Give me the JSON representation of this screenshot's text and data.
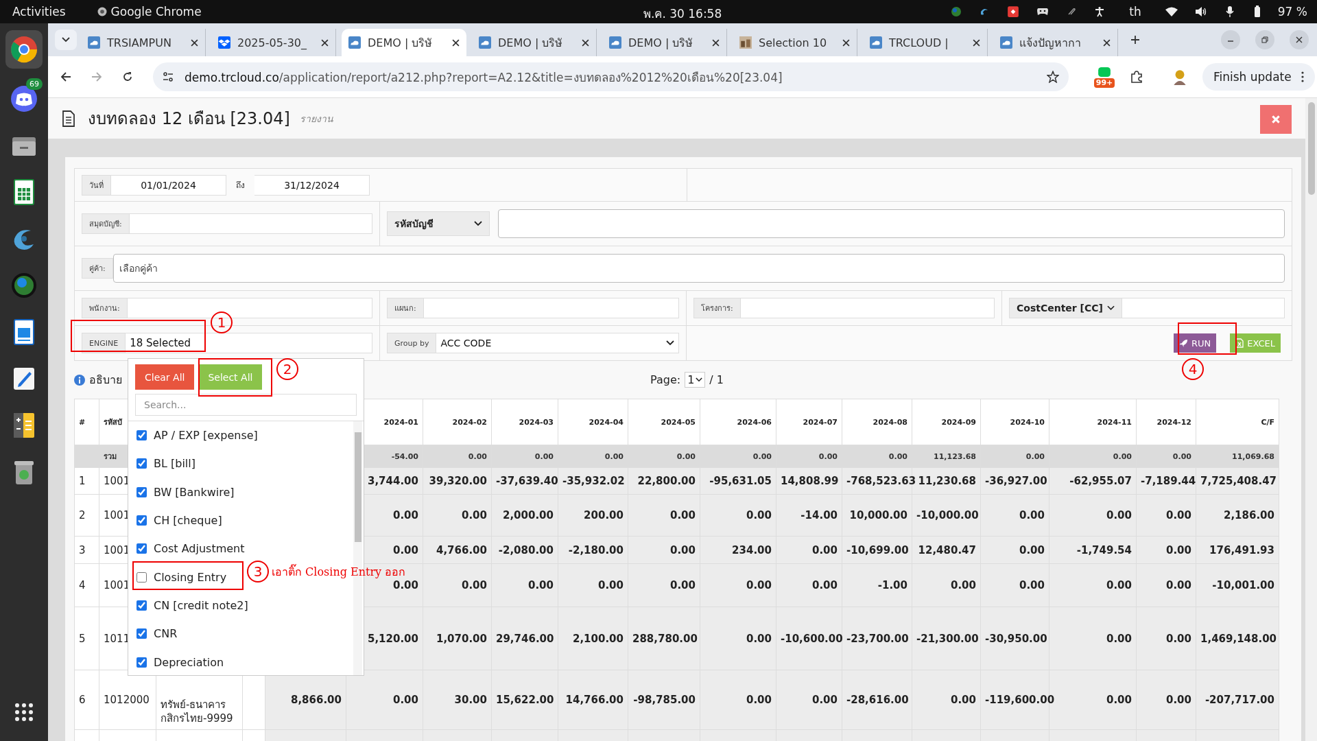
{
  "system_bar": {
    "activities": "Activities",
    "app": "Google Chrome",
    "clock": "พ.ค. 30  16:58",
    "language": "th",
    "battery": "97 %"
  },
  "dock": {
    "badge": "69"
  },
  "browser": {
    "tabs": [
      {
        "title": "TRSIAMPUN",
        "kind": "cloud",
        "selected": false
      },
      {
        "title": "2025-05-30_",
        "kind": "dropbox",
        "selected": false
      },
      {
        "title": "DEMO | บริษั",
        "kind": "cloud",
        "selected": true
      },
      {
        "title": "DEMO | บริษั",
        "kind": "cloud",
        "selected": false
      },
      {
        "title": "DEMO | บริษั",
        "kind": "cloud",
        "selected": false
      },
      {
        "title": "Selection 10",
        "kind": "photo",
        "selected": false
      },
      {
        "title": "TRCLOUD |",
        "kind": "cloud",
        "selected": false
      },
      {
        "title": "แจ้งปัญหากา",
        "kind": "cloud",
        "selected": false
      }
    ],
    "url_host": "demo.trcloud.co",
    "url_path": "/application/report/a212.php?report=A2.12&title=งบทดลอง%2012%20เดือน%20[23.04]",
    "extension_badge": "99+",
    "update_button": "Finish update"
  },
  "page": {
    "title": "งบทดลอง 12 เดือน [23.04]",
    "subtitle": "รายงาน"
  },
  "filters": {
    "date_label": "วันที่",
    "date_from": "01/01/2024",
    "date_to_label": "ถึง",
    "date_to": "31/12/2024",
    "ledger_label": "สมุดบัญชี:",
    "account_select": "รหัสบัญชี",
    "partner_label": "คู่ค้า:",
    "partner_placeholder": "เลือกคู่ค้า",
    "employee_label": "พนักงาน:",
    "department_label": "แผนก:",
    "project_label": "โครงการ:",
    "cost_center_select": "CostCenter [CC]",
    "engine_label": "ENGINE",
    "engine_value": "18 Selected",
    "group_by_label": "Group by",
    "group_by_value": "ACC CODE"
  },
  "actions": {
    "run": "RUN",
    "excel": "EXCEL"
  },
  "engine_dropdown": {
    "clear": "Clear All",
    "select_all": "Select All",
    "search_placeholder": "Search...",
    "options": [
      {
        "label": "AP / EXP [expense]",
        "checked": true
      },
      {
        "label": "BL [bill]",
        "checked": true
      },
      {
        "label": "BW [Bankwire]",
        "checked": true
      },
      {
        "label": "CH [cheque]",
        "checked": true
      },
      {
        "label": "Cost Adjustment",
        "checked": true
      },
      {
        "label": "Closing Entry",
        "checked": false
      },
      {
        "label": "CN [credit note2]",
        "checked": true
      },
      {
        "label": "CNR",
        "checked": true
      },
      {
        "label": "Depreciation",
        "checked": true
      }
    ]
  },
  "legend": "อธิบาย",
  "pagination": {
    "label": "Page:",
    "page": "1",
    "total": "/ 1"
  },
  "table": {
    "columns": [
      "#",
      "รหัสบั",
      "2024-01",
      "2024-02",
      "2024-03",
      "2024-04",
      "2024-05",
      "2024-06",
      "2024-07",
      "2024-08",
      "2024-09",
      "2024-10",
      "2024-11",
      "2024-12",
      "C/F"
    ],
    "summary": {
      "label": "รวม",
      "values": [
        "-54.00",
        "0.00",
        "0.00",
        "0.00",
        "0.00",
        "0.00",
        "0.00",
        "0.00",
        "11,123.68",
        "0.00",
        "0.00",
        "0.00",
        "11,069.68"
      ]
    },
    "rows": [
      {
        "number": "1",
        "code": "1001",
        "values": [
          "3,744.00",
          "39,320.00",
          "-37,639.40",
          "-35,932.02",
          "22,800.00",
          "-95,631.05",
          "14,808.99",
          "-768,523.63",
          "11,230.68",
          "-36,927.00",
          "-62,955.07",
          "-7,189.44",
          "7,725,408.47"
        ]
      },
      {
        "number": "2",
        "code": "1001",
        "values": [
          "0.00",
          "0.00",
          "2,000.00",
          "200.00",
          "0.00",
          "0.00",
          "-14.00",
          "10,000.00",
          "-10,000.00",
          "0.00",
          "0.00",
          "0.00",
          "2,186.00"
        ]
      },
      {
        "number": "3",
        "code": "1001",
        "values": [
          "0.00",
          "4,766.00",
          "-2,080.00",
          "-2,180.00",
          "0.00",
          "234.00",
          "0.00",
          "-10,699.00",
          "12,480.47",
          "0.00",
          "-1,749.54",
          "0.00",
          "176,491.93"
        ]
      },
      {
        "number": "4",
        "code": "1001",
        "values": [
          "0.00",
          "0.00",
          "0.00",
          "0.00",
          "0.00",
          "0.00",
          "0.00",
          "-1.00",
          "0.00",
          "0.00",
          "0.00",
          "0.00",
          "-10,001.00"
        ]
      },
      {
        "number": "5",
        "code": "1011",
        "values": [
          "5,120.00",
          "1,070.00",
          "29,746.00",
          "2,100.00",
          "288,780.00",
          "0.00",
          "-10,600.00",
          "-23,700.00",
          "-21,300.00",
          "-30,950.00",
          "0.00",
          "0.00",
          "1,469,148.00"
        ]
      },
      {
        "number": "6",
        "code": "1012000",
        "description": "ทรัพย์-ธนาคาร กสิกรไทย-9999",
        "opening": "8,866.00",
        "values": [
          "0.00",
          "30.00",
          "15,622.00",
          "14,766.00",
          "-98,785.00",
          "0.00",
          "0.00",
          "-28,616.00",
          "0.00",
          "-119,600.00",
          "0.00",
          "0.00",
          "-207,717.00"
        ]
      }
    ]
  },
  "annotations": [
    {
      "number": "1"
    },
    {
      "number": "2"
    },
    {
      "number": "3",
      "note": "เอาติ๊ก Closing Entry ออก"
    },
    {
      "number": "4"
    }
  ]
}
